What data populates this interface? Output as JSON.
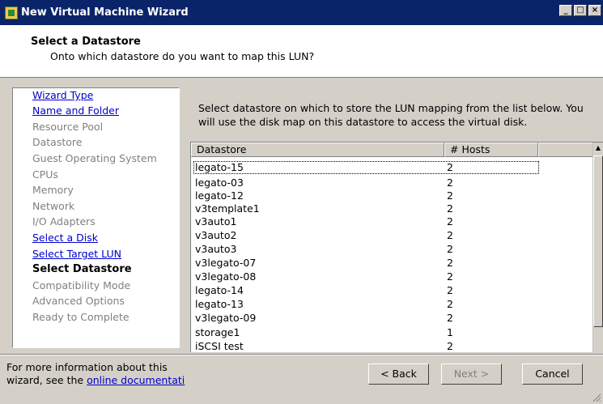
{
  "window": {
    "title": "New Virtual Machine Wizard"
  },
  "header": {
    "title": "Select a Datastore",
    "subtitle": "Onto which datastore do you want to map this LUN?"
  },
  "steps": [
    {
      "label": "Wizard Type",
      "state": "link"
    },
    {
      "label": "Name and Folder",
      "state": "link"
    },
    {
      "label": "Resource Pool",
      "state": "disabled"
    },
    {
      "label": "Datastore",
      "state": "disabled"
    },
    {
      "label": "Guest Operating System",
      "state": "disabled"
    },
    {
      "label": "CPUs",
      "state": "disabled"
    },
    {
      "label": "Memory",
      "state": "disabled"
    },
    {
      "label": "Network",
      "state": "disabled"
    },
    {
      "label": "I/O Adapters",
      "state": "disabled"
    },
    {
      "label": "Select a Disk",
      "state": "link"
    },
    {
      "label": "Select Target LUN",
      "state": "link"
    },
    {
      "label": "Select Datastore",
      "state": "current"
    },
    {
      "label": "Compatibility Mode",
      "state": "disabled"
    },
    {
      "label": "Advanced Options",
      "state": "disabled"
    },
    {
      "label": "Ready to Complete",
      "state": "disabled"
    }
  ],
  "instructions": "Select datastore on which to store the LUN mapping from the list below. You will use the disk map on this datastore to access the virtual disk.",
  "table": {
    "columns": [
      "Datastore",
      "# Hosts"
    ],
    "rows": [
      [
        "legato-15",
        "2"
      ],
      [
        "legato-03",
        "2"
      ],
      [
        "legato-12",
        "2"
      ],
      [
        "v3template1",
        "2"
      ],
      [
        "v3auto1",
        "2"
      ],
      [
        "v3auto2",
        "2"
      ],
      [
        "v3auto3",
        "2"
      ],
      [
        "v3legato-07",
        "2"
      ],
      [
        "v3legato-08",
        "2"
      ],
      [
        "legato-14",
        "2"
      ],
      [
        "legato-13",
        "2"
      ],
      [
        "v3legato-09",
        "2"
      ],
      [
        "storage1",
        "1"
      ],
      [
        "iSCSI test",
        "2"
      ]
    ]
  },
  "footer": {
    "text_line1": "For more information about this",
    "text_line2_prefix": "wizard, see the ",
    "link": "online documentati",
    "back": "< Back",
    "next": "Next >",
    "cancel": "Cancel"
  }
}
